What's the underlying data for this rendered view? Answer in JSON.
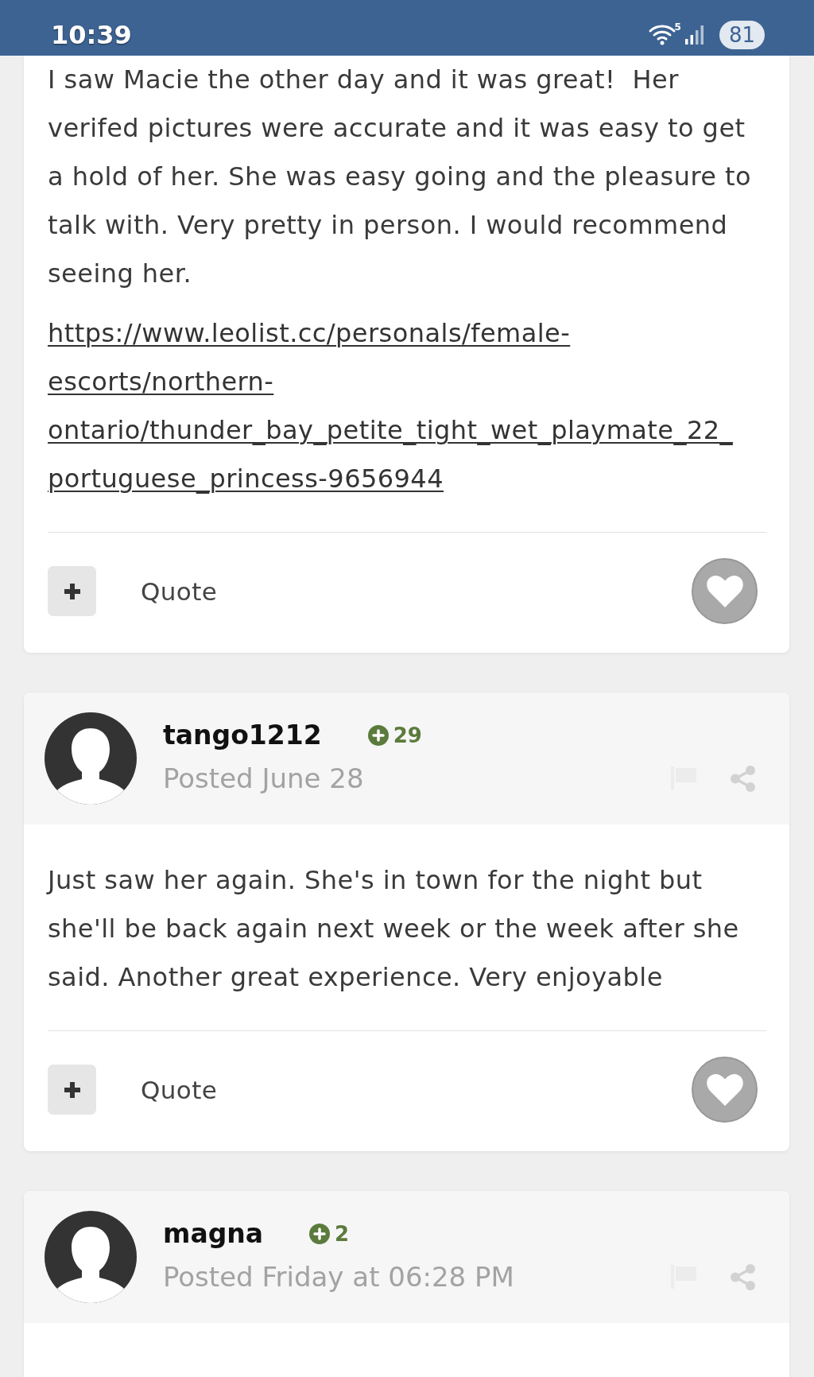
{
  "status_bar": {
    "time": "10:39",
    "network_label": "5",
    "battery": "81"
  },
  "posts": [
    {
      "body": {
        "paragraphs": [
          "I saw Macie the other day and it was great!  Her verifed pictures were accurate and it was easy to get a hold of her. She was easy going and the pleasure to talk with. Very pretty in person. I would recommend seeing her."
        ],
        "link": "https://www.leolist.cc/personals/female-escorts/northern-ontario/thunder_bay_petite_tight_wet_playmate_22_portuguese_princess-9656944"
      },
      "footer": {
        "quote_label": "Quote",
        "liked": false
      }
    },
    {
      "author": {
        "name": "tango1212",
        "reputation": "29",
        "posted": "Posted June 28"
      },
      "body": {
        "paragraphs": [
          "Just saw her again. She's in town for the night but she'll be back again next week or the week after she said. Another great experience. Very enjoyable"
        ]
      },
      "footer": {
        "quote_label": "Quote",
        "liked": false
      }
    },
    {
      "author": {
        "name": "magna",
        "reputation": "2",
        "posted": "Posted Friday at 06:28 PM"
      }
    }
  ]
}
